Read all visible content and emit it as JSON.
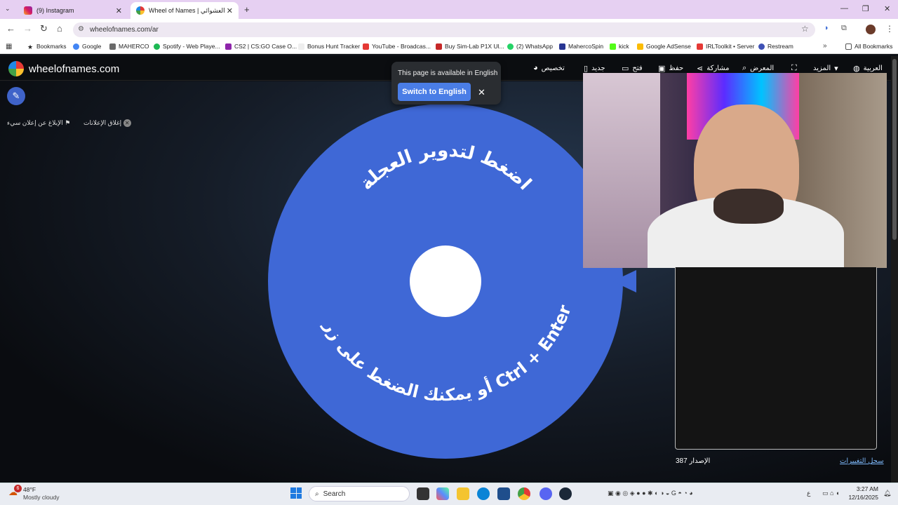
{
  "browser": {
    "tabs": [
      {
        "title": "(9) Instagram"
      },
      {
        "title": "Wheel of Names | اسم العشوائي"
      }
    ],
    "url": "wheelofnames.com/ar",
    "bookmarks": [
      {
        "label": "Bookmarks"
      },
      {
        "label": "Google"
      },
      {
        "label": "MAHERCO"
      },
      {
        "label": "Spotify - Web Playe..."
      },
      {
        "label": "CS2 | CS:GO Case O..."
      },
      {
        "label": "Bonus Hunt Tracker"
      },
      {
        "label": "YouTube - Broadcas..."
      },
      {
        "label": "Buy Sim-Lab P1X Ul..."
      },
      {
        "label": "(2) WhatsApp"
      },
      {
        "label": "MahercoSpin"
      },
      {
        "label": "kick"
      },
      {
        "label": "Google AdSense"
      },
      {
        "label": "IRLToolkit • Server"
      },
      {
        "label": "Restream"
      }
    ],
    "all_bookmarks": "All Bookmarks"
  },
  "site": {
    "name": "wheelofnames.com",
    "menu": {
      "customize": "تخصيص",
      "new": "جديد",
      "open": "فتح",
      "save": "حفظ",
      "share": "مشاركة",
      "gallery": "المعرض",
      "more": "المزيد",
      "language": "العربية"
    },
    "close_ads": "إغلاق الإعلانات",
    "report_ad": "الإبلاغ عن إعلان سيء"
  },
  "wheel": {
    "line1": "اضغط لتدوير العجلة",
    "line2": "أو يمكنك الضغط على زر Ctrl + Enter"
  },
  "translate_popup": {
    "message": "This page is available in English",
    "button": "Switch to English"
  },
  "panel": {
    "version_label": "الإصدار",
    "version_number": "387",
    "changelog": "سجل التغييرات"
  },
  "taskbar": {
    "weather_temp": "48°F",
    "weather_desc": "Mostly cloudy",
    "weather_badge": "6",
    "search": "Search",
    "lang": "ع",
    "time": "3:27 AM",
    "date": "12/16/2025"
  }
}
